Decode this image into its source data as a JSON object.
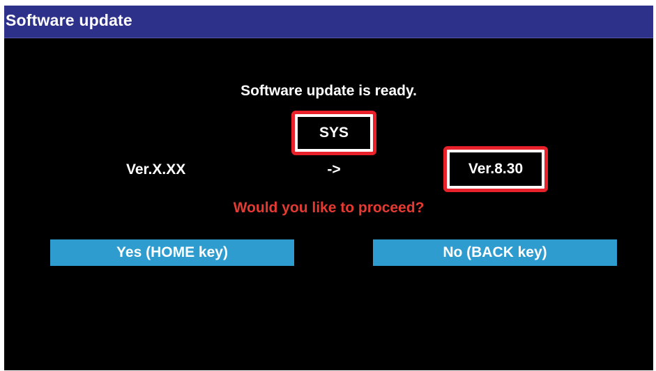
{
  "window": {
    "title": "Software update"
  },
  "dialog": {
    "message": "Software update is ready.",
    "component": "SYS",
    "current_version": "Ver.X.XX",
    "arrow": "->",
    "new_version": "Ver.8.30",
    "prompt": "Would you like to proceed?"
  },
  "buttons": {
    "yes_label": "Yes (HOME key)",
    "no_label": "No (BACK key)"
  },
  "colors": {
    "title_bar": "#2d318a",
    "background": "#000000",
    "highlight_border": "#e8212a",
    "prompt_text": "#e53a32",
    "button": "#2e9ccf"
  }
}
